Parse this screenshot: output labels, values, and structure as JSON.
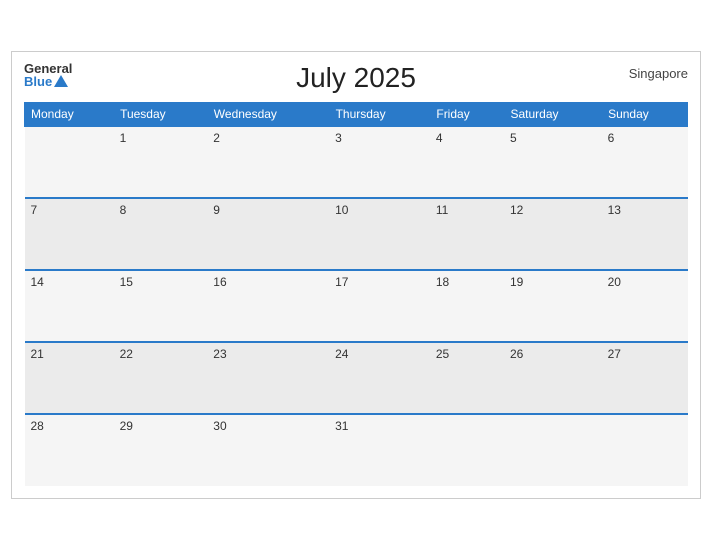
{
  "header": {
    "title": "July 2025",
    "country": "Singapore",
    "logo_general": "General",
    "logo_blue": "Blue"
  },
  "weekdays": [
    "Monday",
    "Tuesday",
    "Wednesday",
    "Thursday",
    "Friday",
    "Saturday",
    "Sunday"
  ],
  "weeks": [
    [
      null,
      "1",
      "2",
      "3",
      "4",
      "5",
      "6"
    ],
    [
      "7",
      "8",
      "9",
      "10",
      "11",
      "12",
      "13"
    ],
    [
      "14",
      "15",
      "16",
      "17",
      "18",
      "19",
      "20"
    ],
    [
      "21",
      "22",
      "23",
      "24",
      "25",
      "26",
      "27"
    ],
    [
      "28",
      "29",
      "30",
      "31",
      null,
      null,
      null
    ]
  ]
}
